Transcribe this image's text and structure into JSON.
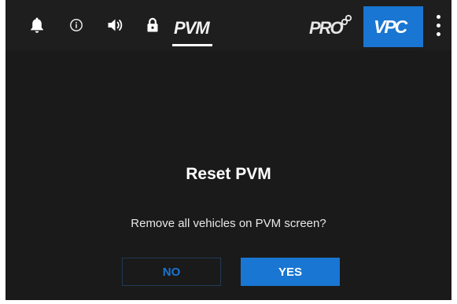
{
  "topbar": {
    "icons": {
      "bell": "bell-icon",
      "info": "info-icon",
      "volume": "volume-icon",
      "lock": "lock-icon"
    },
    "pvm_tab_label": "PVM",
    "pro_label": "PRO",
    "vpc_label": "VPC",
    "more_icon": "more-vert-icon"
  },
  "dialog": {
    "title": "Reset PVM",
    "message": "Remove all vehicles on PVM screen?",
    "no_label": "NO",
    "yes_label": "YES"
  },
  "colors": {
    "background": "#1a1a1a",
    "accent": "#1976d2",
    "text": "#ffffff"
  }
}
